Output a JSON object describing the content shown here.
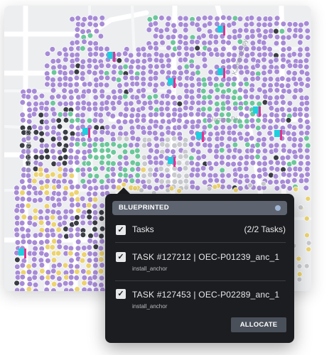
{
  "map": {
    "road_labels": [
      "S Farm Rd 123",
      "Kansas Expy",
      "James Riv"
    ],
    "colors": {
      "background": "#eceef0",
      "road": "#ffffff",
      "purple": "#a78bd6",
      "green": "#6cc79a",
      "dark": "#3a3d44",
      "yellow": "#ecd36f",
      "gray": "#c7c9cd",
      "cyan": "#1ecfe0",
      "magenta": "#e2338f"
    }
  },
  "panel": {
    "header_label": "BLUEPRINTED",
    "tasks_label": "Tasks",
    "tasks_count": "(2/2 Tasks)",
    "tasks": [
      {
        "title": "TASK #127212 | OEC-P01239_anc_1",
        "subtitle": "install_anchor"
      },
      {
        "title": "TASK #127453 | OEC-P02289_anc_1",
        "subtitle": "install_anchor"
      }
    ],
    "allocate_label": "ALLOCATE"
  }
}
